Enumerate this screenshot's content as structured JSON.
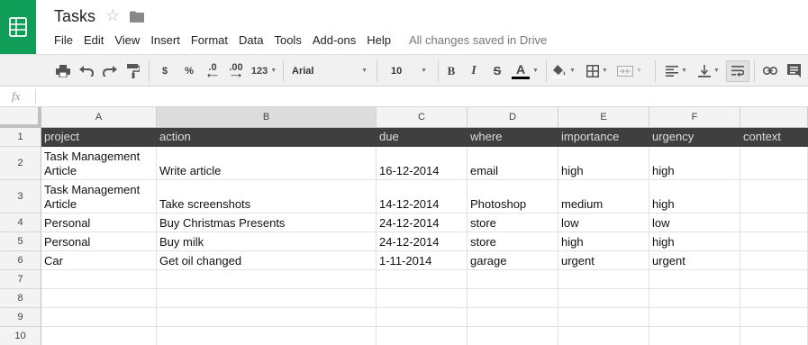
{
  "app": {
    "title": "Tasks",
    "save_status": "All changes saved in Drive",
    "brand_color": "#0f9d58"
  },
  "menu": [
    "File",
    "Edit",
    "View",
    "Insert",
    "Format",
    "Data",
    "Tools",
    "Add-ons",
    "Help"
  ],
  "toolbar": {
    "currency_label": "$",
    "percent_label": "%",
    "decrease_decimals_label": ".0",
    "increase_decimals_label": ".00",
    "number_format_label": "123",
    "font_family_value": "Arial",
    "font_size_value": "10",
    "bold_label": "B",
    "italic_label": "I",
    "strikethrough_label": "S",
    "text_color_label": "A",
    "icons": [
      "print-icon",
      "undo-icon",
      "redo-icon",
      "paint-format-icon",
      "fill-color-icon",
      "borders-icon",
      "merge-cells-icon",
      "align-left-icon",
      "valign-bottom-icon",
      "wrap-text-icon",
      "link-icon",
      "comment-icon"
    ]
  },
  "formula_bar": {
    "fx_label": "fx",
    "value": ""
  },
  "sheet": {
    "columns": [
      "A",
      "B",
      "C",
      "D",
      "E",
      "F",
      ""
    ],
    "selected_column": "B",
    "row_numbers": [
      "1",
      "2",
      "3",
      "4",
      "5",
      "6",
      "7",
      "8",
      "9",
      "10"
    ],
    "rows": [
      [
        "project",
        "action",
        "due",
        "where",
        "importance",
        "urgency",
        "context"
      ],
      [
        "Task Management\nArticle",
        "Write article",
        "16-12-2014",
        "email",
        "high",
        "high",
        ""
      ],
      [
        "Task Management\nArticle",
        "Take screenshots",
        "14-12-2014",
        "Photoshop",
        "medium",
        "high",
        ""
      ],
      [
        "Personal",
        "Buy Christmas Presents",
        "24-12-2014",
        "store",
        "low",
        "low",
        ""
      ],
      [
        "Personal",
        "Buy milk",
        "24-12-2014",
        "store",
        "high",
        "high",
        ""
      ],
      [
        "Car",
        "Get oil changed",
        "1-11-2014",
        "garage",
        "urgent",
        "urgent",
        ""
      ],
      [
        "",
        "",
        "",
        "",
        "",
        "",
        ""
      ],
      [
        "",
        "",
        "",
        "",
        "",
        "",
        ""
      ],
      [
        "",
        "",
        "",
        "",
        "",
        "",
        ""
      ],
      [
        "",
        "",
        "",
        "",
        "",
        "",
        ""
      ]
    ],
    "header_row_bg": "#3f3f3f",
    "header_row_text": "#dddddd"
  }
}
